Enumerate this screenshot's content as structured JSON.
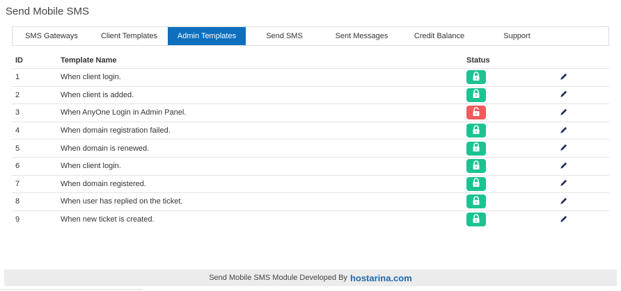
{
  "page": {
    "title": "Send Mobile SMS"
  },
  "tabs": [
    {
      "label": "SMS Gateways",
      "active": false
    },
    {
      "label": "Client Templates",
      "active": false
    },
    {
      "label": "Admin Templates",
      "active": true
    },
    {
      "label": "Send SMS",
      "active": false
    },
    {
      "label": "Sent Messages",
      "active": false
    },
    {
      "label": "Credit Balance",
      "active": false
    },
    {
      "label": "Support",
      "active": false
    }
  ],
  "table": {
    "headers": {
      "id": "ID",
      "name": "Template Name",
      "status": "Status",
      "actions": ""
    },
    "rows": [
      {
        "id": "1",
        "name": "When client login.",
        "status": "enabled"
      },
      {
        "id": "2",
        "name": "When client is added.",
        "status": "enabled"
      },
      {
        "id": "3",
        "name": "When AnyOne Login in Admin Panel.",
        "status": "disabled"
      },
      {
        "id": "4",
        "name": "When domain registration failed.",
        "status": "enabled"
      },
      {
        "id": "5",
        "name": "When domain is renewed.",
        "status": "enabled"
      },
      {
        "id": "6",
        "name": "When client login.",
        "status": "enabled"
      },
      {
        "id": "7",
        "name": "When domain registered.",
        "status": "enabled"
      },
      {
        "id": "8",
        "name": "When user has replied on the ticket.",
        "status": "enabled"
      },
      {
        "id": "9",
        "name": "When new ticket is created.",
        "status": "enabled"
      }
    ]
  },
  "colors": {
    "accent": "#0d6fbd",
    "status_enabled": "#1bc393",
    "status_disabled": "#f25b5b",
    "edit_icon": "#1f2b5c"
  },
  "icons": {
    "status_enabled": "lock-open-icon",
    "status_disabled": "lock-unlocked-icon",
    "edit": "pencil-icon"
  },
  "footer": {
    "text": "Send Mobile SMS Module Developed By",
    "brand": "hostarina.com"
  }
}
